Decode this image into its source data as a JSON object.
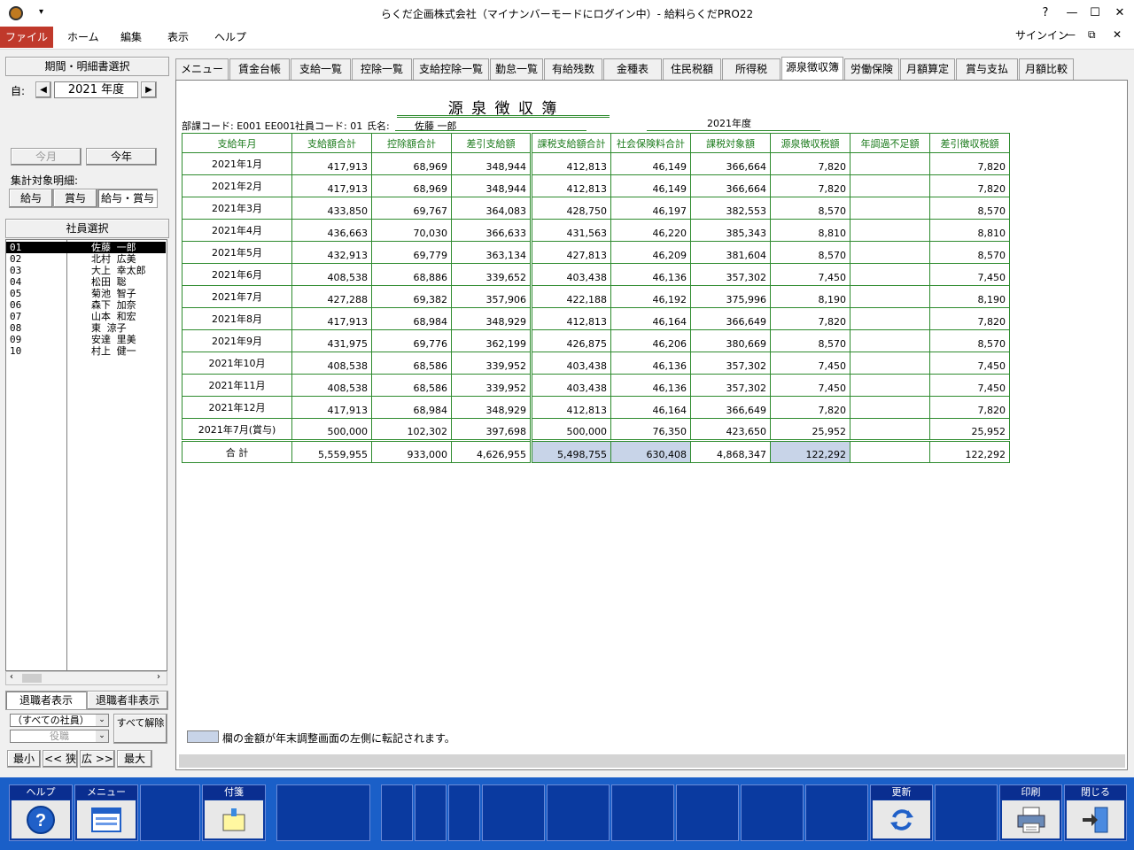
{
  "window": {
    "title": "らくだ企画株式会社（マイナンバーモードにログイン中）- 給料らくだPRO22",
    "help": "?",
    "signin": "サインイン"
  },
  "ribbon": {
    "file": "ファイル",
    "items": [
      "ホーム",
      "編集",
      "表示",
      "ヘルプ"
    ]
  },
  "left": {
    "period_header": "期間・明細書選択",
    "from_label": "自:",
    "year": "2021 年度",
    "this_month": "今月",
    "this_year": "今年",
    "aggregate_label": "集計対象明細:",
    "agg_buttons": [
      "給与",
      "賞与",
      "給与・賞与"
    ],
    "employee_header": "社員選択",
    "employees": [
      {
        "code": "01",
        "name": "佐藤 一郎"
      },
      {
        "code": "02",
        "name": "北村 広美"
      },
      {
        "code": "03",
        "name": "大上 幸太郎"
      },
      {
        "code": "04",
        "name": "松田 聡"
      },
      {
        "code": "05",
        "name": "菊池 智子"
      },
      {
        "code": "06",
        "name": "森下 加奈"
      },
      {
        "code": "07",
        "name": "山本 和宏"
      },
      {
        "code": "08",
        "name": "東 涼子"
      },
      {
        "code": "09",
        "name": "安達 里美"
      },
      {
        "code": "10",
        "name": "村上 健一"
      }
    ],
    "retired_show": "退職者表示",
    "retired_hide": "退職者非表示",
    "filter_all": "（すべての社員）",
    "filter_role": "役職",
    "clear_all": "すべて解除",
    "zoom": [
      "最小",
      "<< 狭",
      "広 >>",
      "最大"
    ]
  },
  "tabs": [
    "メニュー",
    "賃金台帳",
    "支給一覧",
    "控除一覧",
    "支給控除一覧",
    "勤怠一覧",
    "有給残数",
    "金種表",
    "住民税額",
    "所得税",
    "源泉徴収簿",
    "労働保険",
    "月額算定",
    "賞与支払",
    "月額比較"
  ],
  "report": {
    "title": "源 泉 徴 収 簿",
    "dept_code": "部課コード: E001 EE001",
    "emp_code": "社員コード: 01",
    "name_label": "氏名:",
    "name": "佐藤 一郎",
    "fiscal_year": "2021年度",
    "headers": [
      "支給年月",
      "支給額合計",
      "控除額合計",
      "差引支給額",
      "課税支給額合計",
      "社会保険料合計",
      "課税対象額",
      "源泉徴収税額",
      "年調過不足額",
      "差引徴収税額"
    ],
    "rows": [
      [
        "2021年1月",
        "417,913",
        "68,969",
        "348,944",
        "412,813",
        "46,149",
        "366,664",
        "7,820",
        "",
        "7,820"
      ],
      [
        "2021年2月",
        "417,913",
        "68,969",
        "348,944",
        "412,813",
        "46,149",
        "366,664",
        "7,820",
        "",
        "7,820"
      ],
      [
        "2021年3月",
        "433,850",
        "69,767",
        "364,083",
        "428,750",
        "46,197",
        "382,553",
        "8,570",
        "",
        "8,570"
      ],
      [
        "2021年4月",
        "436,663",
        "70,030",
        "366,633",
        "431,563",
        "46,220",
        "385,343",
        "8,810",
        "",
        "8,810"
      ],
      [
        "2021年5月",
        "432,913",
        "69,779",
        "363,134",
        "427,813",
        "46,209",
        "381,604",
        "8,570",
        "",
        "8,570"
      ],
      [
        "2021年6月",
        "408,538",
        "68,886",
        "339,652",
        "403,438",
        "46,136",
        "357,302",
        "7,450",
        "",
        "7,450"
      ],
      [
        "2021年7月",
        "427,288",
        "69,382",
        "357,906",
        "422,188",
        "46,192",
        "375,996",
        "8,190",
        "",
        "8,190"
      ],
      [
        "2021年8月",
        "417,913",
        "68,984",
        "348,929",
        "412,813",
        "46,164",
        "366,649",
        "7,820",
        "",
        "7,820"
      ],
      [
        "2021年9月",
        "431,975",
        "69,776",
        "362,199",
        "426,875",
        "46,206",
        "380,669",
        "8,570",
        "",
        "8,570"
      ],
      [
        "2021年10月",
        "408,538",
        "68,586",
        "339,952",
        "403,438",
        "46,136",
        "357,302",
        "7,450",
        "",
        "7,450"
      ],
      [
        "2021年11月",
        "408,538",
        "68,586",
        "339,952",
        "403,438",
        "46,136",
        "357,302",
        "7,450",
        "",
        "7,450"
      ],
      [
        "2021年12月",
        "417,913",
        "68,984",
        "348,929",
        "412,813",
        "46,164",
        "366,649",
        "7,820",
        "",
        "7,820"
      ],
      [
        "2021年7月(賞与)",
        "500,000",
        "102,302",
        "397,698",
        "500,000",
        "76,350",
        "423,650",
        "25,952",
        "",
        "25,952"
      ]
    ],
    "total": [
      "合 計",
      "5,559,955",
      "933,000",
      "4,626,955",
      "5,498,755",
      "630,408",
      "4,868,347",
      "122,292",
      "",
      "122,292"
    ],
    "legend": "欄の金額が年末調整画面の左側に転記されます。",
    "highlight_color": "#c8d4e8"
  },
  "toolbar": {
    "help": "ヘルプ",
    "menu": "メニュー",
    "note": "付箋",
    "refresh": "更新",
    "print": "印刷",
    "close": "閉じる"
  }
}
